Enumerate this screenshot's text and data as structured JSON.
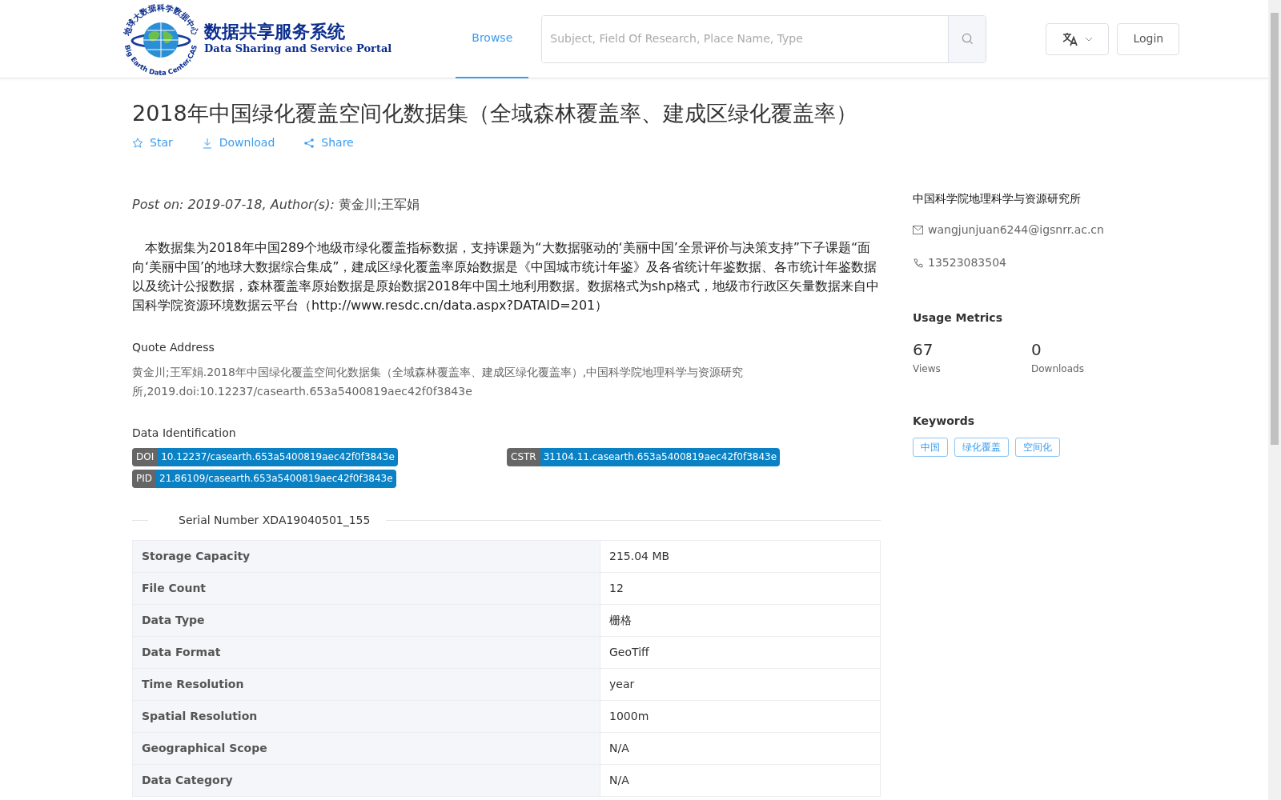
{
  "header": {
    "logo": {
      "arc_top": "地球大数据科学数据中心",
      "arc_bottom": "Big Earth Data Center,CAS",
      "title_cn": "数据共享服务系统",
      "title_en": "Data Sharing and Service Portal"
    },
    "nav": [
      {
        "label": "Browse",
        "selected": true
      }
    ],
    "search": {
      "placeholder": "Subject, Field Of Research, Place Name, Type"
    },
    "login": "Login"
  },
  "dataset": {
    "title": "2018年中国绿化覆盖空间化数据集（全域森林覆盖率、建成区绿化覆盖率）",
    "actions": [
      {
        "kind": "star",
        "label": "Star"
      },
      {
        "kind": "download",
        "label": "Download"
      },
      {
        "kind": "share",
        "label": "Share"
      }
    ],
    "post_on": "Post on: 2019-07-18, Author(s):",
    "authors": "黄金川;王军娟",
    "description": "　本数据集为2018年中国289个地级市绿化覆盖指标数据，支持课题为“大数据驱动的‘美丽中国’全景评价与决策支持”下子课题“面向‘美丽中国’的地球大数据综合集成”，建成区绿化覆盖率原始数据是《中国城市统计年鉴》及各省统计年鉴数据、各市统计年鉴数据以及统计公报数据，森林覆盖率原始数据是原始数据2018年中国土地利用数据。数据格式为shp格式，地级市行政区矢量数据来自中国科学院资源环境数据云平台（http://www.resdc.cn/data.aspx?DATAID=201）",
    "quote_heading": "Quote Address",
    "quote": "黄金川;王军娟.2018年中国绿化覆盖空间化数据集（全域森林覆盖率、建成区绿化覆盖率）,中国科学院地理科学与资源研究所,2019.doi:10.12237/casearth.653a5400819aec42f0f3843e",
    "identification_heading": "Data Identification",
    "identifiers": [
      {
        "label": "DOI",
        "value": "10.12237/casearth.653a5400819aec42f0f3843e"
      },
      {
        "label": "CSTR",
        "value": "31104.11.casearth.653a5400819aec42f0f3843e"
      },
      {
        "label": "PID",
        "value": "21.86109/casearth.653a5400819aec42f0f3843e"
      }
    ],
    "serial_number": "Serial Number XDA19040501_155",
    "table": {
      "rows": [
        {
          "label": "Storage Capacity",
          "value": "215.04 MB"
        },
        {
          "label": "File Count",
          "value": "12"
        },
        {
          "label": "Data Type",
          "value": "栅格"
        },
        {
          "label": "Data Format",
          "value": "GeoTiff"
        },
        {
          "label": "Time Resolution",
          "value": "year"
        },
        {
          "label": "Spatial Resolution",
          "value": "1000m"
        },
        {
          "label": "Geographical Scope",
          "value": "N/A"
        },
        {
          "label": "Data Category",
          "value": "N/A"
        }
      ]
    }
  },
  "sidebar": {
    "institution": "中国科学院地理科学与资源研究所",
    "email": "wangjunjuan6244@igsnrr.ac.cn",
    "phone": "13523083504",
    "metrics_heading": "Usage Metrics",
    "metrics": [
      {
        "value": "67",
        "label": "Views"
      },
      {
        "value": "0",
        "label": "Downloads"
      }
    ],
    "keywords_heading": "Keywords",
    "keywords": [
      "中国",
      "绿化覆盖",
      "空间化"
    ]
  }
}
